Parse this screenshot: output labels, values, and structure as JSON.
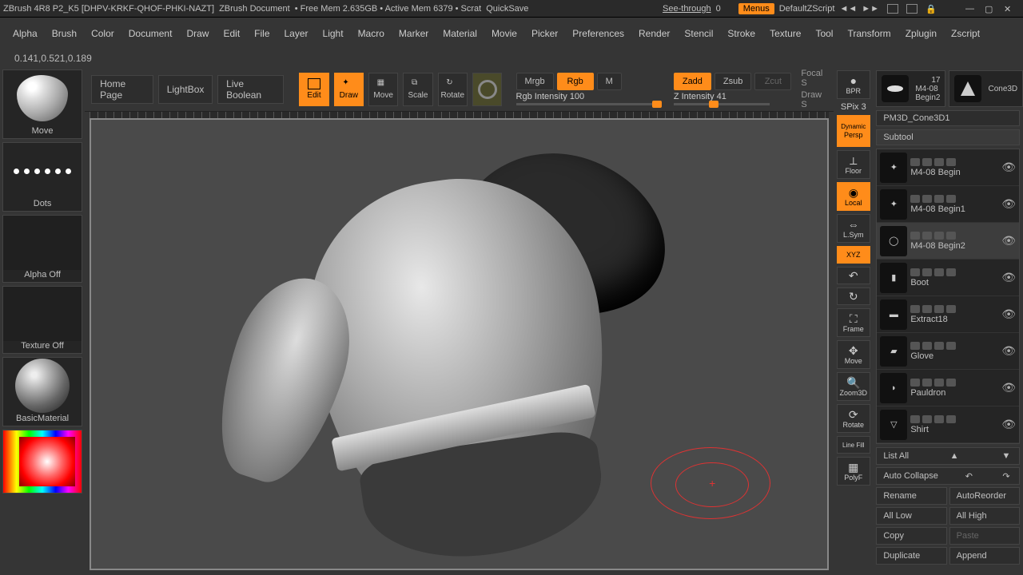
{
  "titlebar": {
    "app": "ZBrush 4R8 P2_K5 [DHPV-KRKF-QHOF-PHKI-NAZT]",
    "doc": "ZBrush Document",
    "mem": "• Free Mem 2.635GB • Active Mem 6379 • Scrat",
    "quicksave": "QuickSave",
    "seethrough_lbl": "See-through",
    "seethrough_val": "0",
    "menus": "Menus",
    "zscript": "DefaultZScript"
  },
  "menus": [
    "Alpha",
    "Brush",
    "Color",
    "Document",
    "Draw",
    "Edit",
    "File",
    "Layer",
    "Light",
    "Macro",
    "Marker",
    "Material",
    "Movie",
    "Picker",
    "Preferences",
    "Render",
    "Stencil",
    "Stroke",
    "Texture",
    "Tool",
    "Transform",
    "Zplugin",
    "Zscript"
  ],
  "rgbinfo": "0.141,0.521,0.189",
  "left": {
    "home": "Home Page",
    "lightbox": "LightBox",
    "liveboolean": "Live Boolean",
    "move": "Move",
    "dots": "Dots",
    "alpha": "Alpha Off",
    "texture": "Texture Off",
    "material": "BasicMaterial"
  },
  "toolbar": {
    "edit": "Edit",
    "draw": "Draw",
    "move": "Move",
    "scale": "Scale",
    "rotate": "Rotate",
    "mrgb": "Mrgb",
    "rgb": "Rgb",
    "m": "M",
    "rgb_intensity_lbl": "Rgb Intensity",
    "rgb_intensity_val": "100",
    "zadd": "Zadd",
    "zsub": "Zsub",
    "zcut": "Zcut",
    "z_intensity_lbl": "Z Intensity",
    "z_intensity_val": "41",
    "focal": "Focal S",
    "drawsize": "Draw S"
  },
  "rightstrip": {
    "bpr": "BPR",
    "spix_lbl": "SPix",
    "spix_val": "3",
    "dynamic": "Dynamic",
    "persp": "Persp",
    "floor": "Floor",
    "local": "Local",
    "lsym": "L.Sym",
    "xyz": "XYZ",
    "frame": "Frame",
    "move": "Move",
    "zoom": "Zoom3D",
    "rotate": "Rotate",
    "linefill": "Line Fill",
    "polyf": "PolyF"
  },
  "tools": {
    "slot1": {
      "name": "M4-08 Begin2",
      "count": "17"
    },
    "slot2": {
      "name": "Cone3D"
    },
    "path": "PM3D_Cone3D1"
  },
  "subtool": {
    "header": "Subtool",
    "items": [
      {
        "name": "M4-08 Begin"
      },
      {
        "name": "M4-08 Begin1"
      },
      {
        "name": "M4-08 Begin2",
        "sel": true
      },
      {
        "name": "Boot"
      },
      {
        "name": "Extract18"
      },
      {
        "name": "Glove"
      },
      {
        "name": "Pauldron"
      },
      {
        "name": "Shirt"
      }
    ],
    "listall": "List All",
    "autocollapse": "Auto Collapse",
    "rename": "Rename",
    "autoreorder": "AutoReorder",
    "alllow": "All Low",
    "allhigh": "All High",
    "copy": "Copy",
    "paste": "Paste",
    "duplicate": "Duplicate",
    "append": "Append"
  }
}
